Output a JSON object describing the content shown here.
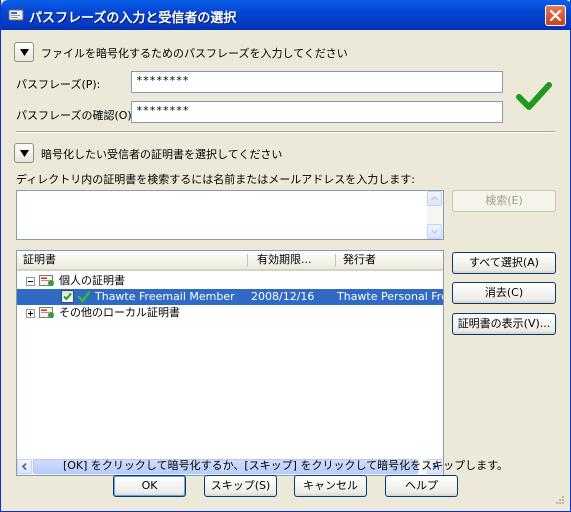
{
  "window": {
    "title": "パスフレーズの入力と受信者の選択"
  },
  "passphrase_section": {
    "header": "ファイルを暗号化するためのパスフレーズを入力してください",
    "passphrase_label": "パスフレーズ(P):",
    "passphrase_value": "********",
    "confirm_label": "パスフレーズの確認(O):",
    "confirm_value": "********"
  },
  "recipient_section": {
    "header": "暗号化したい受信者の証明書を選択してください",
    "search_hint": "ディレクトリ内の証明書を検索するには名前またはメールアドレスを入力します:",
    "search_button": "検索(E)"
  },
  "cert_list": {
    "columns": [
      "証明書",
      "有効期限...",
      "発行者"
    ],
    "groups": [
      {
        "label": "個人の証明書",
        "expanded": true,
        "items": [
          {
            "name": "Thawte Freemail Member",
            "expires": "2008/12/16",
            "issuer": "Thawte Personal Freemail",
            "checked": true
          }
        ]
      },
      {
        "label": "その他のローカル証明書",
        "expanded": false,
        "items": []
      }
    ]
  },
  "side_buttons": {
    "select_all": "すべて選択(A)",
    "clear": "消去(C)",
    "show_cert": "証明書の表示(V)..."
  },
  "status": "[OK] をクリックして暗号化するか、[スキップ] をクリックして暗号化をスキップします。",
  "buttons": {
    "ok": "OK",
    "skip": "スキップ(S)",
    "cancel": "キャンセル",
    "help": "ヘルプ"
  },
  "colors": {
    "titlebar": "#0545d3",
    "dialog_bg": "#ece9d8",
    "selection": "#316ac5",
    "check_green": "#1e9b1e"
  }
}
